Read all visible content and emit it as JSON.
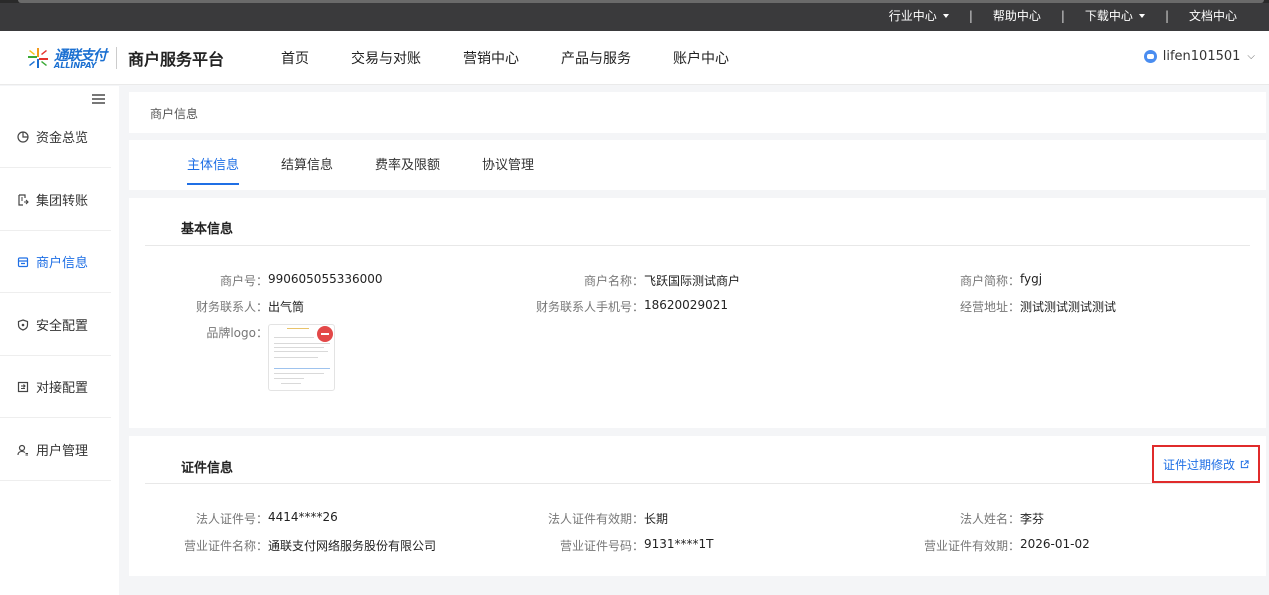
{
  "topbar": {
    "links": [
      {
        "label": "行业中心",
        "dropdown": true
      },
      {
        "label": "帮助中心",
        "dropdown": false
      },
      {
        "label": "下载中心",
        "dropdown": true
      },
      {
        "label": "文档中心",
        "dropdown": false
      }
    ],
    "separator": "|"
  },
  "header": {
    "logo_cn": "通联支付",
    "logo_en": "ALLINPAY",
    "brand": "商户服务平台",
    "nav": [
      "首页",
      "交易与对账",
      "营销中心",
      "产品与服务",
      "账户中心"
    ],
    "user": "lifen101501"
  },
  "sidebar": {
    "items": [
      {
        "label": "资金总览",
        "icon": "pie-chart-icon",
        "active": false
      },
      {
        "label": "集团转账",
        "icon": "transfer-doc-icon",
        "active": false
      },
      {
        "label": "商户信息",
        "icon": "store-icon",
        "active": true
      },
      {
        "label": "安全配置",
        "icon": "shield-icon",
        "active": false
      },
      {
        "label": "对接配置",
        "icon": "connect-icon",
        "active": false
      },
      {
        "label": "用户管理",
        "icon": "user-icon",
        "active": false
      }
    ]
  },
  "breadcrumb": "商户信息",
  "tabs": [
    {
      "label": "主体信息",
      "active": true
    },
    {
      "label": "结算信息",
      "active": false
    },
    {
      "label": "费率及限额",
      "active": false
    },
    {
      "label": "协议管理",
      "active": false
    }
  ],
  "basic": {
    "title": "基本信息",
    "fields": [
      {
        "label": "商户号",
        "value": "990605055336000"
      },
      {
        "label": "商户名称",
        "value": "飞跃国际测试商户"
      },
      {
        "label": "商户简称",
        "value": "fygj"
      },
      {
        "label": "财务联系人",
        "value": "出气筒"
      },
      {
        "label": "财务联系人手机号",
        "value": "18620029021"
      },
      {
        "label": "经营地址",
        "value": "测试测试测试测试"
      }
    ],
    "logo_label": "品牌logo"
  },
  "cert": {
    "title": "证件信息",
    "edit_link": "证件过期修改",
    "fields": [
      {
        "label": "法人证件号",
        "value": "4414****26"
      },
      {
        "label": "法人证件有效期",
        "value": "长期"
      },
      {
        "label": "法人姓名",
        "value": "李芬"
      },
      {
        "label": "营业证件名称",
        "value": "通联支付网络服务股份有限公司"
      },
      {
        "label": "营业证件号码",
        "value": "9131****1T"
      },
      {
        "label": "营业证件有效期",
        "value": "2026-01-02"
      }
    ]
  },
  "colors": {
    "accent": "#1f6fe5",
    "highlight_border": "#e02b2b",
    "remove_button": "#e34848",
    "topbar": "#3a3a3c"
  }
}
